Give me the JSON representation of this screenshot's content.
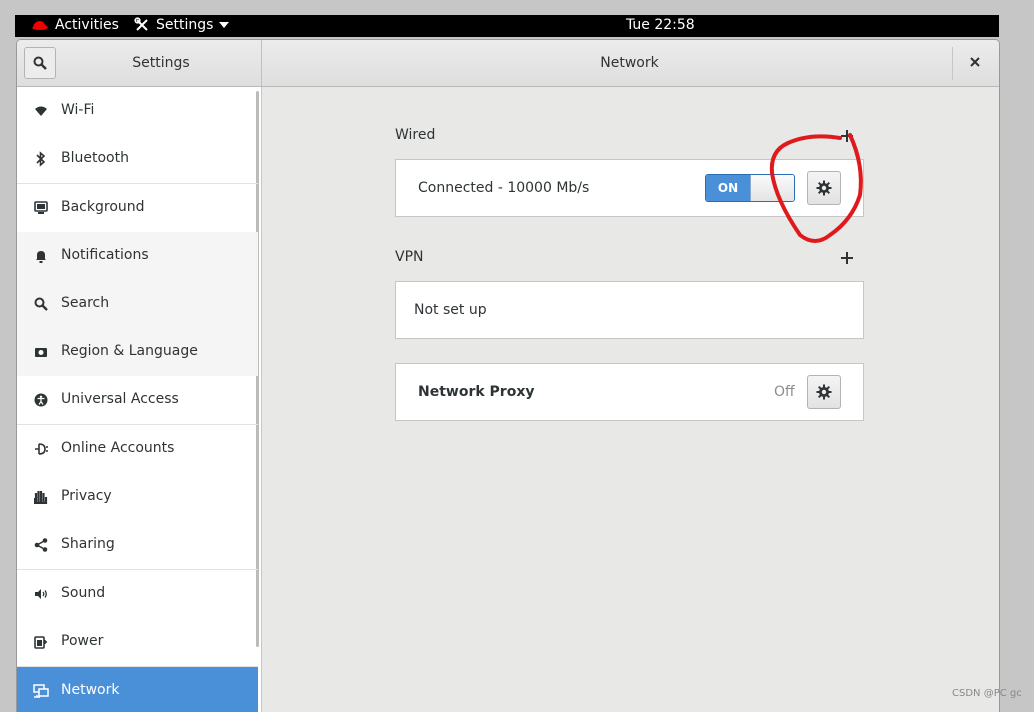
{
  "topbar": {
    "activities": "Activities",
    "app_menu": "Settings",
    "clock": "Tue 22:58"
  },
  "header": {
    "sidebar_title": "Settings",
    "title": "Network"
  },
  "sidebar": {
    "items": [
      {
        "label": "Wi-Fi",
        "icon": "wifi-icon"
      },
      {
        "label": "Bluetooth",
        "icon": "bluetooth-icon"
      },
      {
        "label": "Background",
        "icon": "background-icon"
      },
      {
        "label": "Notifications",
        "icon": "bell-icon"
      },
      {
        "label": "Search",
        "icon": "search-icon"
      },
      {
        "label": "Region & Language",
        "icon": "region-icon"
      },
      {
        "label": "Universal Access",
        "icon": "accessibility-icon"
      },
      {
        "label": "Online Accounts",
        "icon": "online-accounts-icon"
      },
      {
        "label": "Privacy",
        "icon": "hand-icon"
      },
      {
        "label": "Sharing",
        "icon": "share-icon"
      },
      {
        "label": "Sound",
        "icon": "speaker-icon"
      },
      {
        "label": "Power",
        "icon": "power-icon"
      },
      {
        "label": "Network",
        "icon": "network-icon",
        "selected": true
      }
    ]
  },
  "wired": {
    "section_label": "Wired",
    "status": "Connected - 10000 Mb/s",
    "switch_label": "ON",
    "switch_on": true
  },
  "vpn": {
    "section_label": "VPN",
    "status": "Not set up"
  },
  "proxy": {
    "label": "Network Proxy",
    "value": "Off"
  },
  "watermark": "CSDN @PC gc",
  "colors": {
    "accent": "#4a90d9",
    "annotation": "#e0191c"
  }
}
